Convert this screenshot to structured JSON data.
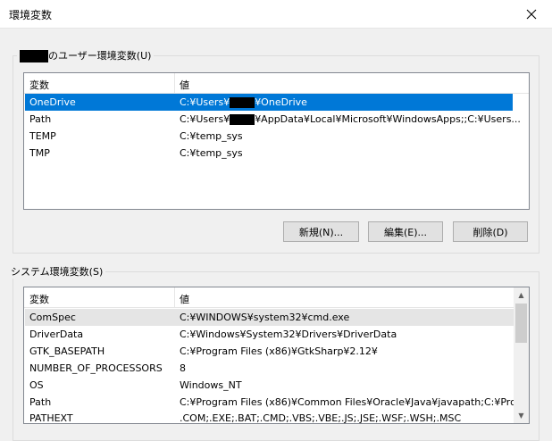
{
  "window": {
    "title": "環境変数"
  },
  "user_group": {
    "label": "のユーザー環境変数(U)",
    "columns": [
      "変数",
      "値"
    ],
    "rows": [
      {
        "name": "OneDrive",
        "value_prefix": "C:¥Users¥",
        "value_suffix": "¥OneDrive"
      },
      {
        "name": "Path",
        "value_prefix": "C:¥Users¥",
        "value_suffix": "¥AppData¥Local¥Microsoft¥WindowsApps;;C:¥Users..."
      },
      {
        "name": "TEMP",
        "value_prefix": "C:¥temp_sys",
        "value_suffix": ""
      },
      {
        "name": "TMP",
        "value_prefix": "C:¥temp_sys",
        "value_suffix": ""
      }
    ],
    "buttons": {
      "new": "新規(N)...",
      "edit": "編集(E)...",
      "delete": "削除(D)"
    }
  },
  "system_group": {
    "label": "システム環境変数(S)",
    "columns": [
      "変数",
      "値"
    ],
    "rows": [
      {
        "name": "ComSpec",
        "value": "C:¥WINDOWS¥system32¥cmd.exe"
      },
      {
        "name": "DriverData",
        "value": "C:¥Windows¥System32¥Drivers¥DriverData"
      },
      {
        "name": "GTK_BASEPATH",
        "value": "C:¥Program Files (x86)¥GtkSharp¥2.12¥"
      },
      {
        "name": "NUMBER_OF_PROCESSORS",
        "value": "8"
      },
      {
        "name": "OS",
        "value": "Windows_NT"
      },
      {
        "name": "Path",
        "value": "C:¥Program Files (x86)¥Common Files¥Oracle¥Java¥javapath;C:¥Pro..."
      },
      {
        "name": "PATHEXT",
        "value": ".COM;.EXE;.BAT;.CMD;.VBS;.VBE;.JS;.JSE;.WSF;.WSH;.MSC"
      }
    ]
  },
  "colors": {
    "selection": "#0078d7",
    "hover": "#e5e5e5"
  }
}
